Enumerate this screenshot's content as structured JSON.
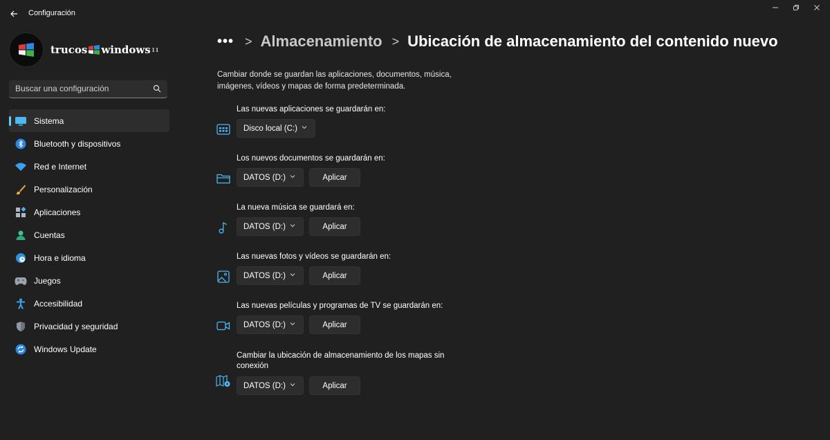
{
  "window": {
    "title": "Configuración",
    "controls": [
      "minimize-icon",
      "restore-icon",
      "close-icon"
    ]
  },
  "logo": {
    "text_left": "trucos",
    "text_right": "windows",
    "superscript": "11"
  },
  "search": {
    "placeholder": "Buscar una configuración"
  },
  "sidebar": {
    "items": [
      {
        "label": "Sistema",
        "icon": "system-icon",
        "active": true
      },
      {
        "label": "Bluetooth y dispositivos",
        "icon": "bluetooth-icon"
      },
      {
        "label": "Red e Internet",
        "icon": "wifi-icon"
      },
      {
        "label": "Personalización",
        "icon": "brush-icon"
      },
      {
        "label": "Aplicaciones",
        "icon": "apps-icon"
      },
      {
        "label": "Cuentas",
        "icon": "account-icon"
      },
      {
        "label": "Hora e idioma",
        "icon": "globe-clock-icon"
      },
      {
        "label": "Juegos",
        "icon": "gamepad-icon"
      },
      {
        "label": "Accesibilidad",
        "icon": "accessibility-icon"
      },
      {
        "label": "Privacidad y seguridad",
        "icon": "shield-icon"
      },
      {
        "label": "Windows Update",
        "icon": "update-icon"
      }
    ]
  },
  "breadcrumb": {
    "more": "•••",
    "separator": ">",
    "parent": "Almacenamiento",
    "current": "Ubicación de almacenamiento del contenido nuevo"
  },
  "description": "Cambiar donde se guardan las aplicaciones, documentos, música, imágenes, vídeos y mapas de forma predeterminada.",
  "settings": [
    {
      "label": "Las nuevas aplicaciones se guardarán en:",
      "icon": "apps-storage-icon",
      "value": "Disco local (C:)"
    },
    {
      "label": "Los nuevos documentos se guardarán en:",
      "icon": "folder-icon",
      "value": "DATOS (D:)",
      "button": "Aplicar"
    },
    {
      "label": "La nueva música se guardará en:",
      "icon": "music-note-icon",
      "value": "DATOS (D:)",
      "button": "Aplicar"
    },
    {
      "label": "Las nuevas fotos y vídeos se guardarán en:",
      "icon": "image-icon",
      "value": "DATOS (D:)",
      "button": "Aplicar"
    },
    {
      "label": "Las nuevas películas y programas de TV se guardarán en:",
      "icon": "video-camera-icon",
      "value": "DATOS (D:)",
      "button": "Aplicar"
    },
    {
      "label": "Cambiar la ubicación de almacenamiento de los mapas sin conexión",
      "icon": "map-icon",
      "value": "DATOS (D:)",
      "button": "Aplicar"
    }
  ],
  "colors": {
    "accent": "#60cdff",
    "background": "#202020",
    "control": "#2d2d2d"
  }
}
